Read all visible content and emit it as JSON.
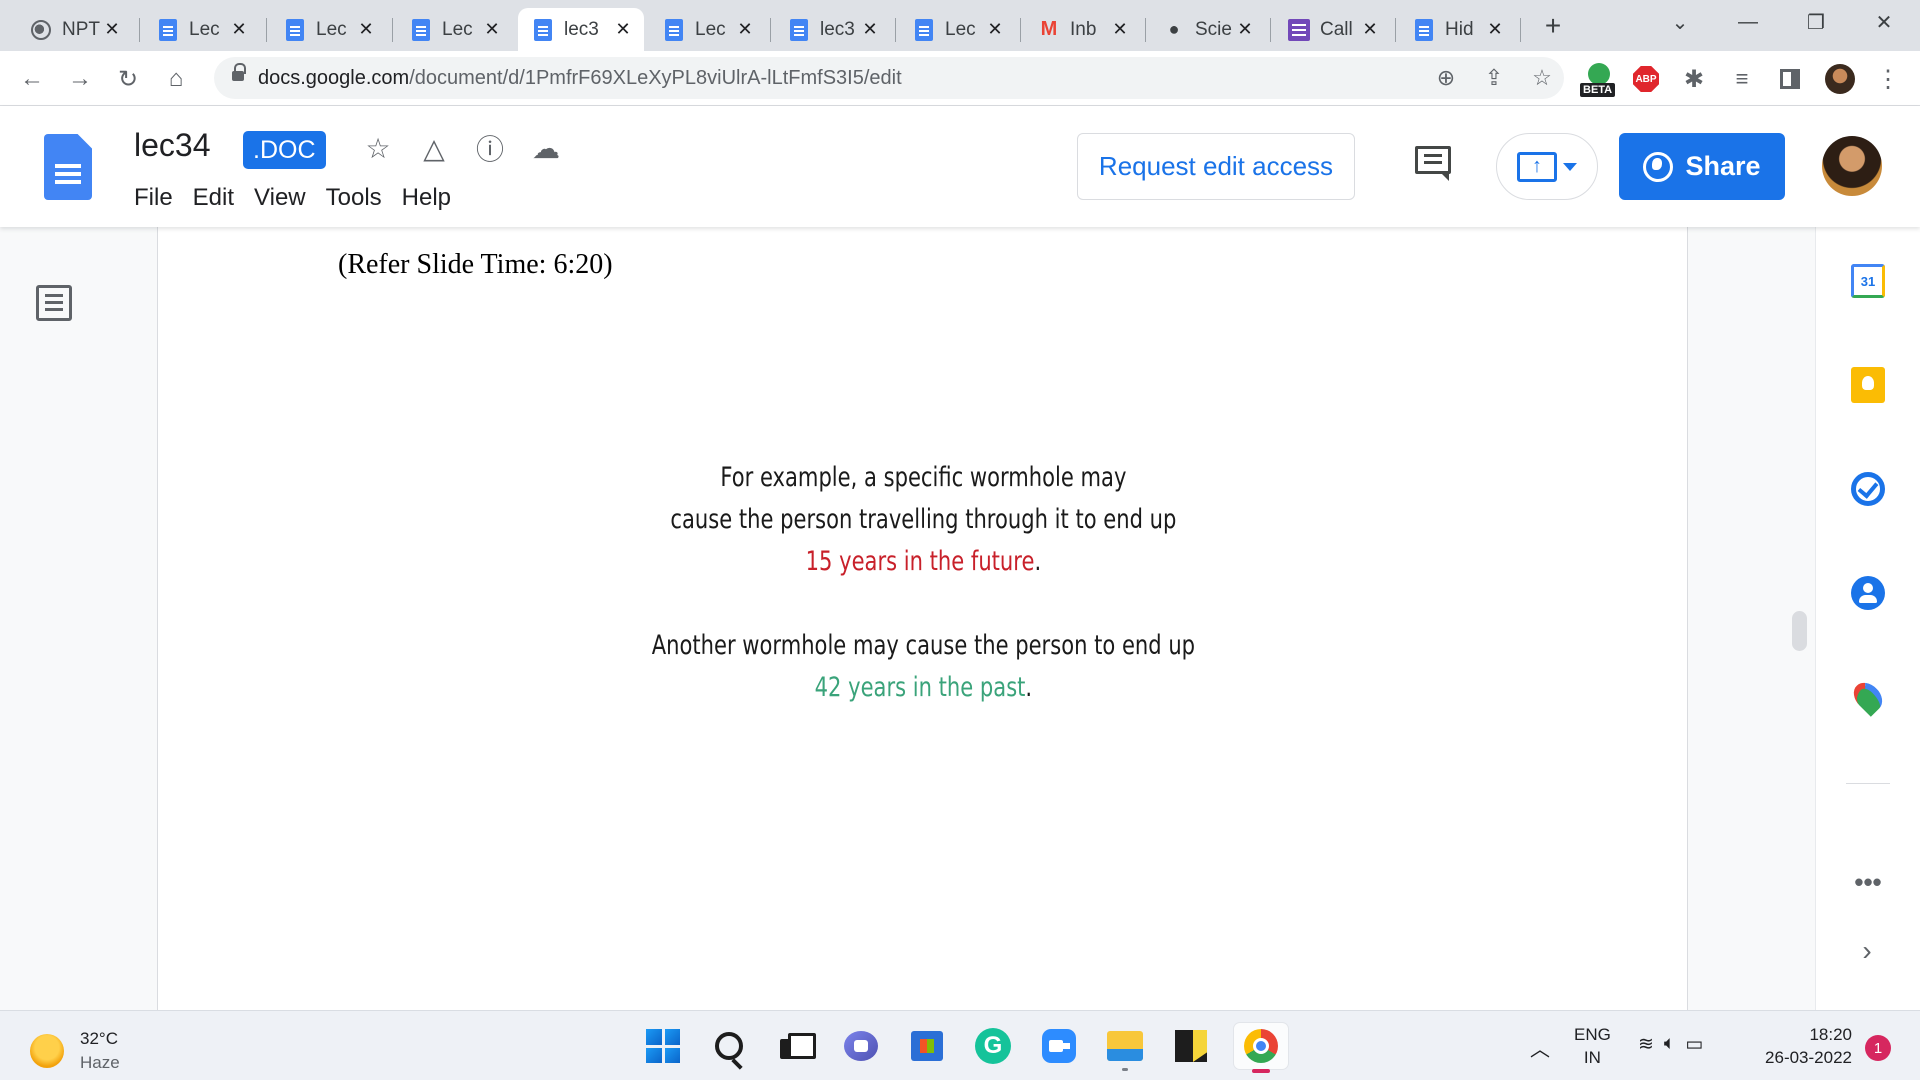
{
  "browser": {
    "tabs": [
      {
        "title": "NPT",
        "icon": "globe-icon"
      },
      {
        "title": "Lec",
        "icon": "docs-icon"
      },
      {
        "title": "Lec",
        "icon": "docs-icon"
      },
      {
        "title": "Lec",
        "icon": "docs-icon"
      },
      {
        "title": "lec3",
        "icon": "docs-icon"
      },
      {
        "title": "Lec",
        "icon": "docs-icon"
      },
      {
        "title": "lec3",
        "icon": "docs-icon"
      },
      {
        "title": "Lec",
        "icon": "docs-icon"
      },
      {
        "title": "Inb",
        "icon": "gmail-icon"
      },
      {
        "title": "Scie",
        "icon": "chat-icon"
      },
      {
        "title": "Call",
        "icon": "forms-icon"
      },
      {
        "title": "Hid",
        "icon": "docs-icon"
      }
    ],
    "active_tab_index": 4,
    "url_host": "docs.google.com",
    "url_path": "/document/d/1PmfrF69XLeXyPL8viUlrA-lLtFmfS3I5/edit",
    "extensions": {
      "beta_label": "BETA",
      "abp_label": "ABP"
    }
  },
  "docs": {
    "title": "lec34",
    "badge": ".DOC",
    "menu": [
      "File",
      "Edit",
      "View",
      "Tools",
      "Help"
    ],
    "request_edit_label": "Request edit access",
    "share_label": "Share",
    "accent": "#1a73e8"
  },
  "document": {
    "refer": "(Refer Slide Time: 6:20)",
    "slide": {
      "line1": "For example, a specific wormhole may",
      "line2": "cause the person travelling through it to end up",
      "line3_highlight": "15 years in the future",
      "line3_end": ".",
      "line4": "Another wormhole may cause the person to end up",
      "line5_highlight": "42 years in the past",
      "line5_end": ".",
      "future_color": "#c8202a",
      "past_color": "#3aa37a"
    }
  },
  "sidepanel": {
    "calendar_day": "31",
    "more": "•••",
    "collapse": "›"
  },
  "taskbar": {
    "temperature": "32°C",
    "weather": "Haze",
    "lang_top": "ENG",
    "lang_bottom": "IN",
    "time": "18:20",
    "date": "26-03-2022",
    "notifications": "1"
  }
}
